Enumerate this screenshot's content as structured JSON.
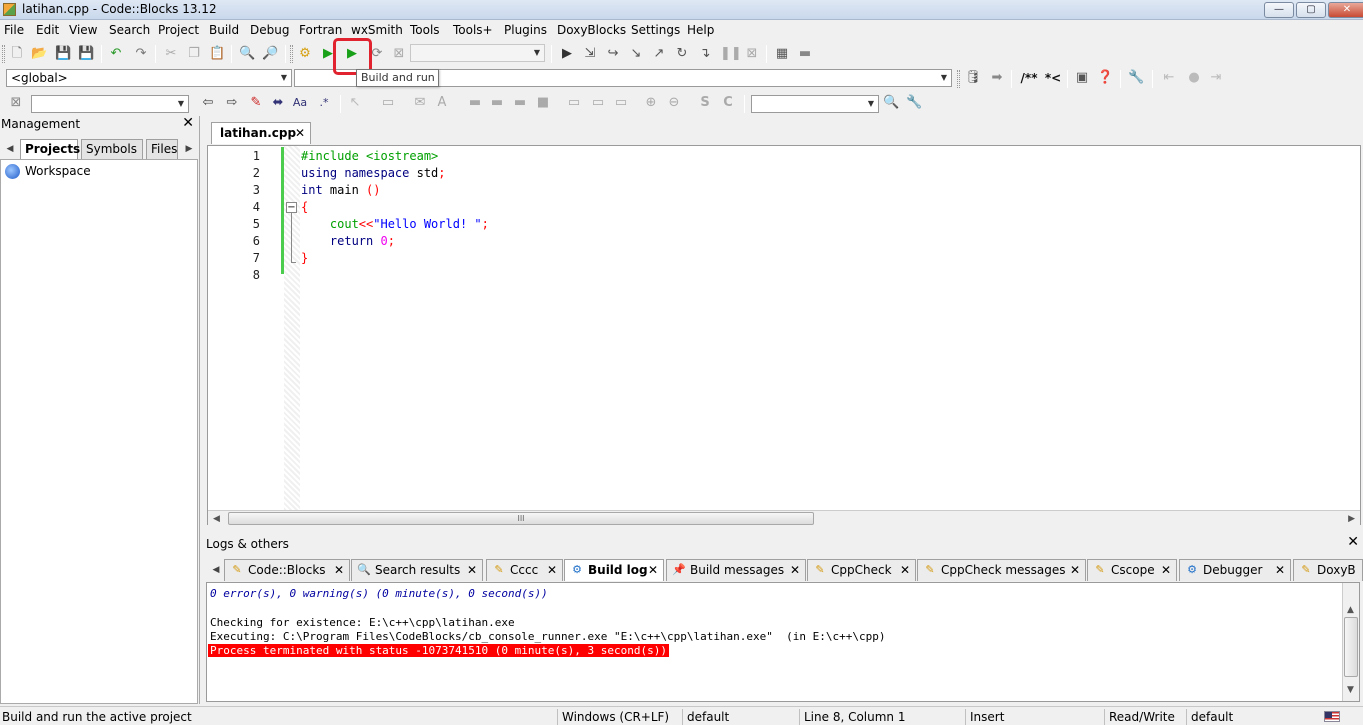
{
  "window": {
    "title": "latihan.cpp - Code::Blocks 13.12",
    "controls": {
      "minimize": "—",
      "maximize": "▢",
      "close": "✕"
    }
  },
  "menu": [
    "File",
    "Edit",
    "View",
    "Search",
    "Project",
    "Build",
    "Debug",
    "Fortran",
    "wxSmith",
    "Tools",
    "Tools+",
    "Plugins",
    "DoxyBlocks",
    "Settings",
    "Help"
  ],
  "toolbar": {
    "build_and_run_tooltip": "Build and run",
    "build_target_value": "",
    "scope_value": "<global>",
    "symbol_value": "",
    "search_value": "",
    "find_value": "",
    "doxy_comment": "/**",
    "doxy_line": "*<",
    "icons": [
      "new-file-icon",
      "open-icon",
      "save-icon",
      "save-all-icon",
      "undo-icon",
      "redo-icon",
      "cut-icon",
      "copy-icon",
      "paste-icon",
      "find-icon",
      "replace-icon",
      "build-icon",
      "run-icon",
      "build-and-run-icon",
      "rebuild-icon",
      "abort-icon",
      "debug-icon",
      "step-into-icon",
      "step-out-icon",
      "next-line-icon",
      "next-instruction-icon",
      "pause-icon",
      "stop-debug-icon"
    ]
  },
  "management": {
    "title": "Management",
    "tabs": [
      "Projects",
      "Symbols",
      "Files"
    ],
    "active_tab": "Projects",
    "tree": [
      "Workspace"
    ]
  },
  "editor": {
    "file_tab": "latihan.cpp",
    "line_numbers": [
      "1",
      "2",
      "3",
      "4",
      "5",
      "6",
      "7",
      "8"
    ],
    "code": {
      "l1": "#include <iostream>",
      "l2a": "using namespace",
      "l2b": " std",
      "l2c": ";",
      "l3a": "int",
      "l3b": " main ",
      "l3c": "()",
      "l4": "{",
      "l5a": "    cout",
      "l5b": "<<",
      "l5c": "\"Hello World! \"",
      "l5d": ";",
      "l6a": "    return",
      "l6b": " 0",
      "l6c": ";",
      "l7": "}"
    },
    "scroll_label": "III"
  },
  "logs": {
    "title": "Logs & others",
    "tabs": [
      "Code::Blocks",
      "Search results",
      "Cccc",
      "Build log",
      "Build messages",
      "CppCheck",
      "CppCheck messages",
      "Cscope",
      "Debugger",
      "DoxyB"
    ],
    "active_tab": "Build log",
    "lines": {
      "summary": "0 error(s), 0 warning(s) (0 minute(s), 0 second(s))",
      "checking": "Checking for existence: E:\\c++\\cpp\\latihan.exe",
      "executing": "Executing: C:\\Program Files\\CodeBlocks/cb_console_runner.exe \"E:\\c++\\cpp\\latihan.exe\"  (in E:\\c++\\cpp)",
      "terminated": "Process terminated with status -1073741510 (0 minute(s), 3 second(s))"
    }
  },
  "status": {
    "message": "Build and run the active project",
    "line_endings": "Windows (CR+LF)",
    "encoding": "default",
    "position": "Line 8, Column 1",
    "mode": "Insert",
    "access": "Read/Write",
    "lexer": "default"
  },
  "colors": {
    "highlight_box": "#e0232e",
    "error_bg": "#ff0000",
    "change_bar": "#4ccc4c",
    "preprocessor": "#00a000",
    "keyword": "#000080",
    "string": "#0000ff",
    "number": "#f000f0",
    "operator": "#ff0000"
  }
}
